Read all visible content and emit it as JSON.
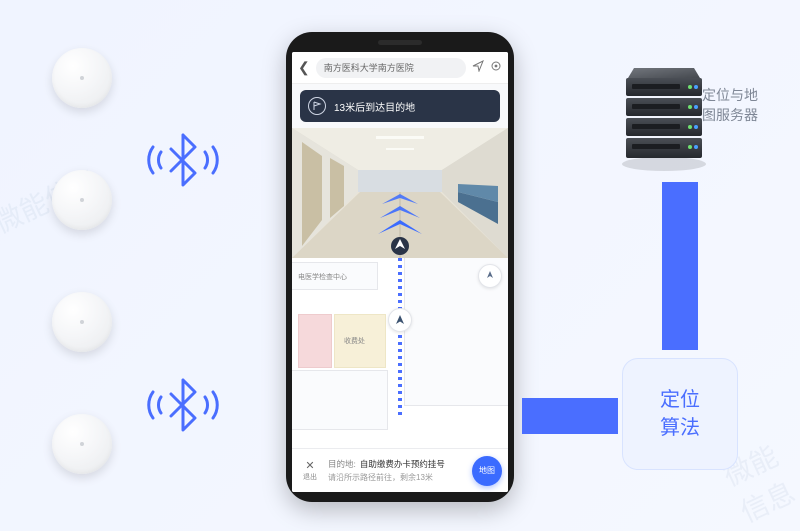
{
  "watermark": "微能信息",
  "beacons": {
    "count": 4
  },
  "phone": {
    "header": {
      "location_pill": "南方医科大学南方医院"
    },
    "banner": "13米后到达目的地",
    "map": {
      "tag1": "电医学检查中心",
      "tag2": "收费处"
    },
    "bottom": {
      "exit_label": "退出",
      "dest_label": "目的地:",
      "dest_value": "自助缴费办卡预约挂号",
      "dest_sub": "请沿所示路径前往，剩余13米",
      "fab": "地图"
    }
  },
  "server_label": "定位与地图服务器",
  "algo_label": "定位\n算法"
}
